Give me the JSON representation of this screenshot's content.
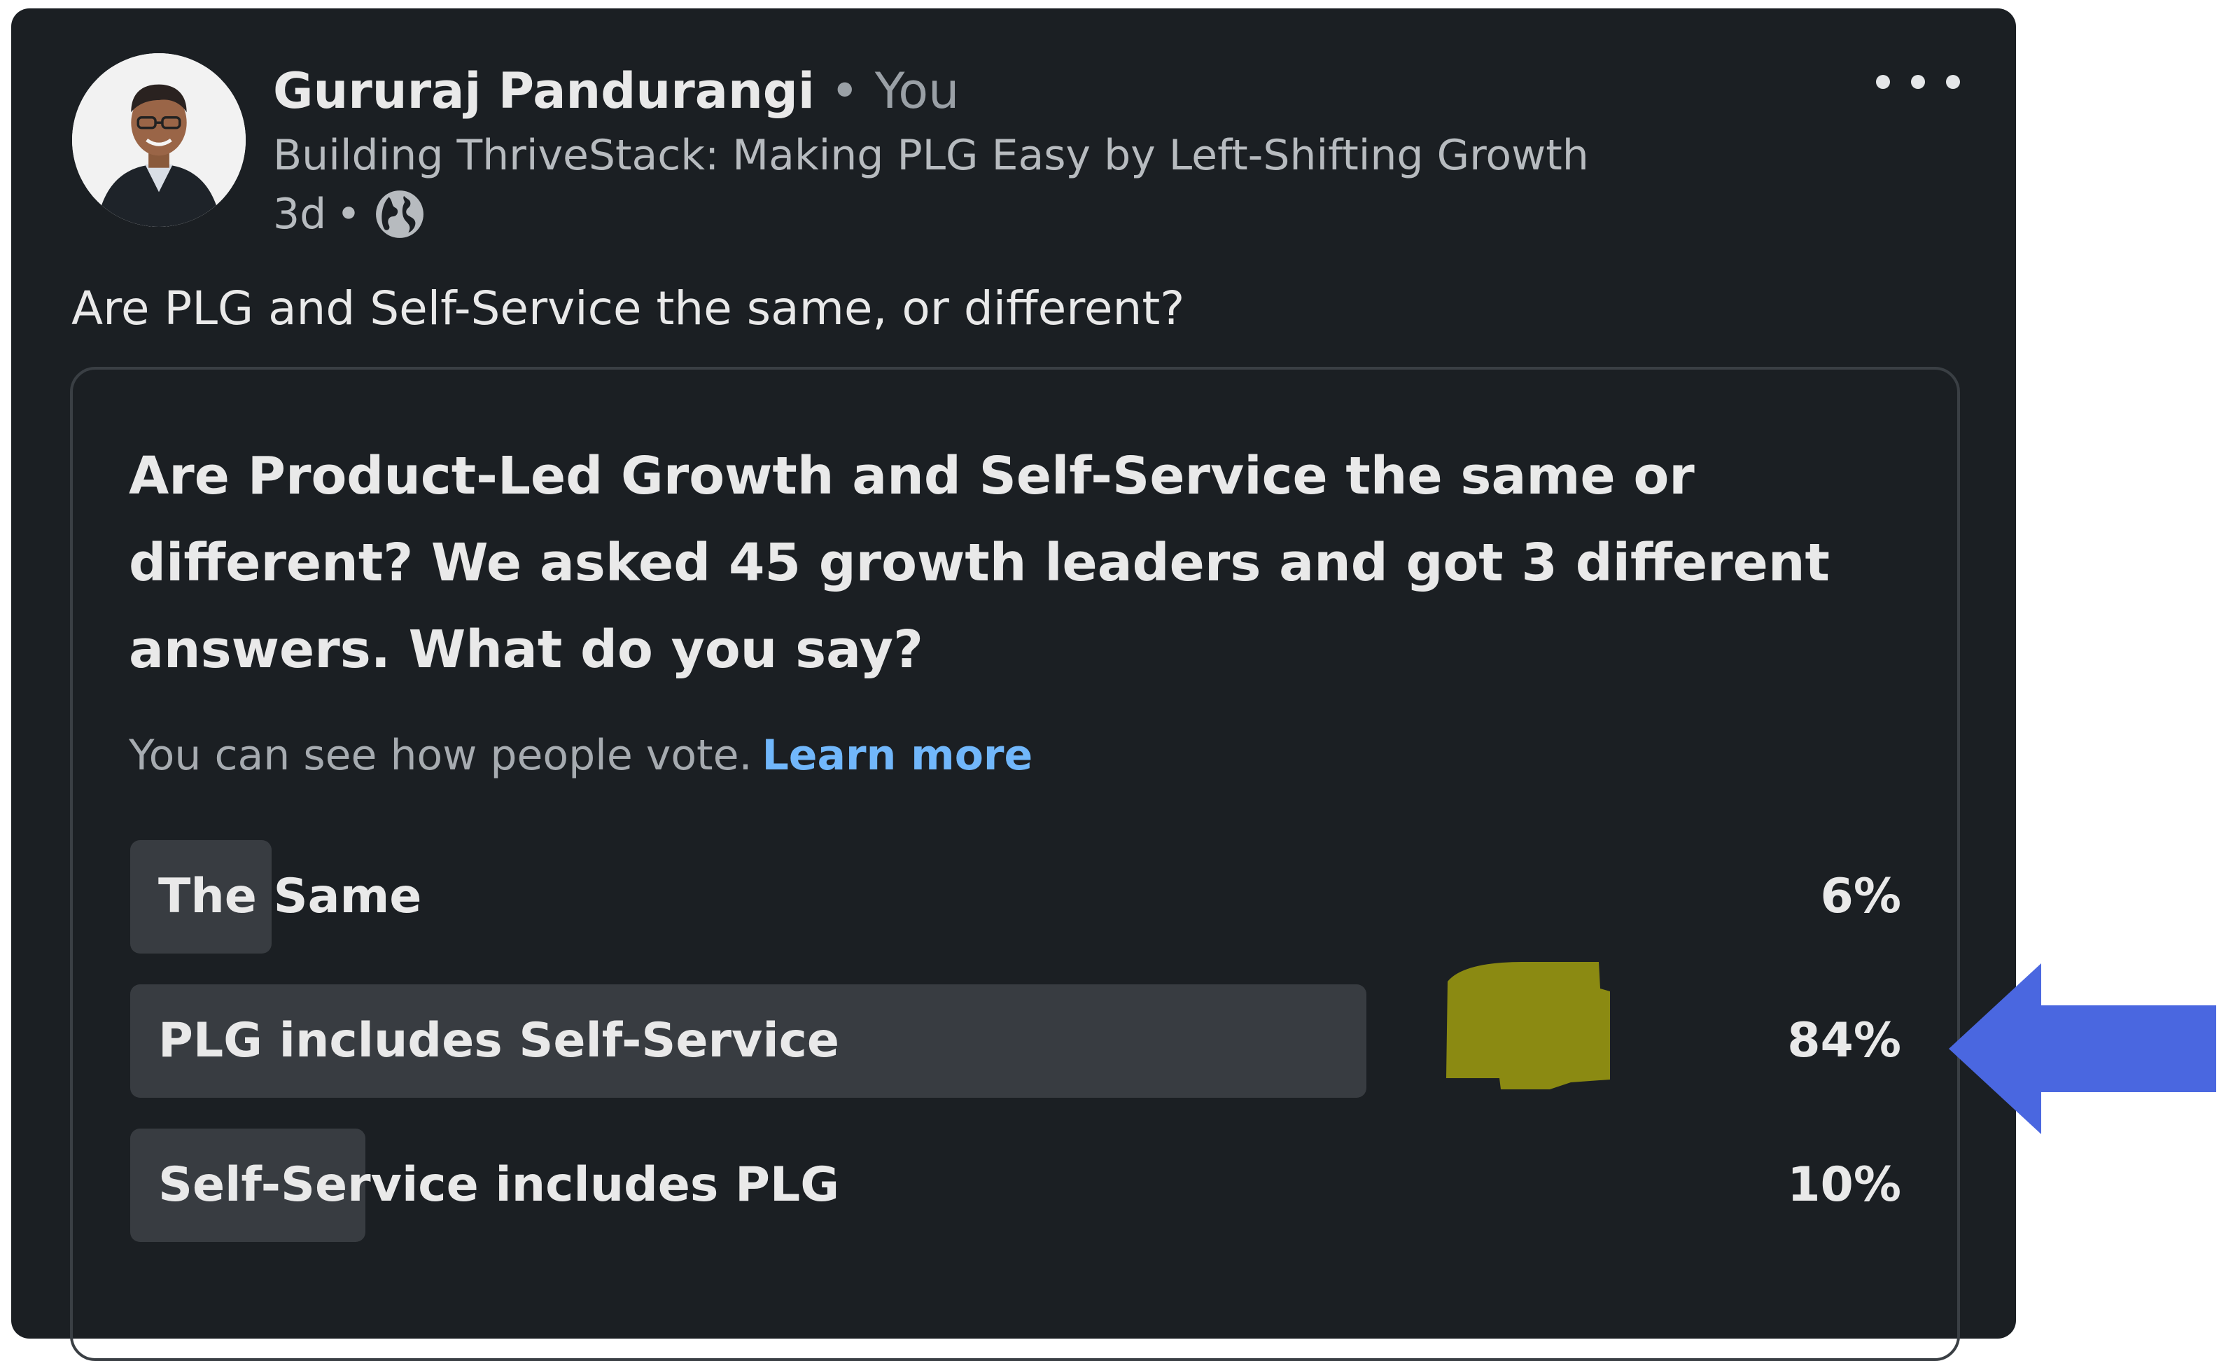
{
  "post": {
    "author_name": "Gururaj Pandurangi",
    "separator": "•",
    "relationship": "You",
    "headline": "Building ThriveStack: Making PLG Easy by Left-Shifting Growth",
    "age": "3d",
    "visibility_icon": "globe-icon",
    "more_icon": "more-horizontal-icon",
    "text": "Are PLG and Self-Service the same, or different?"
  },
  "poll": {
    "question": "Are Product-Led Growth and Self-Service the same or different? We asked 45 growth leaders and got 3 different answers. What do you say?",
    "notice": "You can see how people vote.",
    "learn_more": "Learn more",
    "options": [
      {
        "label": "The Same",
        "percent_text": "6%",
        "percent": 6
      },
      {
        "label": "PLG includes Self-Service",
        "percent_text": "84%",
        "percent": 84
      },
      {
        "label": "Self-Service includes PLG",
        "percent_text": "10%",
        "percent": 10
      }
    ]
  },
  "annotations": {
    "arrow_color": "#4a67e0",
    "scribble_color": "#8b8a12"
  }
}
